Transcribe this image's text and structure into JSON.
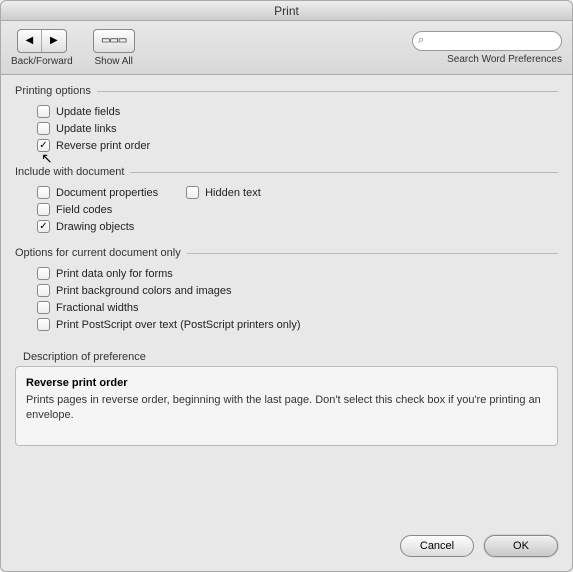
{
  "window": {
    "title": "Print"
  },
  "toolbar": {
    "back_forward_label": "Back/Forward",
    "show_all_label": "Show All",
    "search_placeholder": "",
    "search_label": "Search Word Preferences"
  },
  "sections": {
    "printing_options": {
      "title": "Printing options",
      "update_fields": "Update fields",
      "update_links": "Update links",
      "reverse_print_order": "Reverse print order"
    },
    "include_with_document": {
      "title": "Include with document",
      "document_properties": "Document properties",
      "hidden_text": "Hidden text",
      "field_codes": "Field codes",
      "drawing_objects": "Drawing objects"
    },
    "options_current_doc": {
      "title": "Options for current document only",
      "print_data_forms": "Print data only for forms",
      "print_bg_colors": "Print background colors and images",
      "fractional_widths": "Fractional widths",
      "print_postscript": "Print PostScript over text (PostScript printers only)"
    }
  },
  "checked": {
    "reverse_print_order": true,
    "drawing_objects": true
  },
  "description": {
    "section_title": "Description of preference",
    "heading": "Reverse print order",
    "body": "Prints pages in reverse order, beginning with the last page. Don't select this check box if you're printing an envelope."
  },
  "buttons": {
    "cancel": "Cancel",
    "ok": "OK"
  }
}
